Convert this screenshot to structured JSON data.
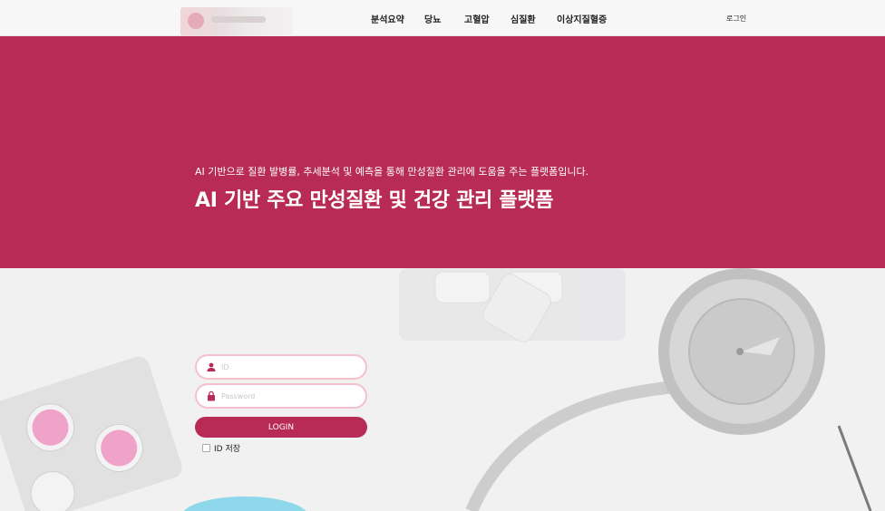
{
  "header": {
    "nav": [
      "분석요약",
      "당뇨",
      "고혈압",
      "심질환",
      "이상지질혈증"
    ],
    "login_link": "로그인"
  },
  "hero": {
    "subtitle": "AI 기반으로 질환 발병률, 추세분석 및 예측을 통해 만성질환 관리에 도움을 주는 플랫폼입니다.",
    "title": "AI 기반 주요 만성질환 및 건강 관리 플랫폼"
  },
  "login_form": {
    "id_placeholder": "ID",
    "password_placeholder": "Password",
    "login_button": "LOGIN",
    "remember_id": "ID 저장"
  },
  "colors": {
    "brand": "#b82b56",
    "field_border": "#f3c0cc"
  }
}
